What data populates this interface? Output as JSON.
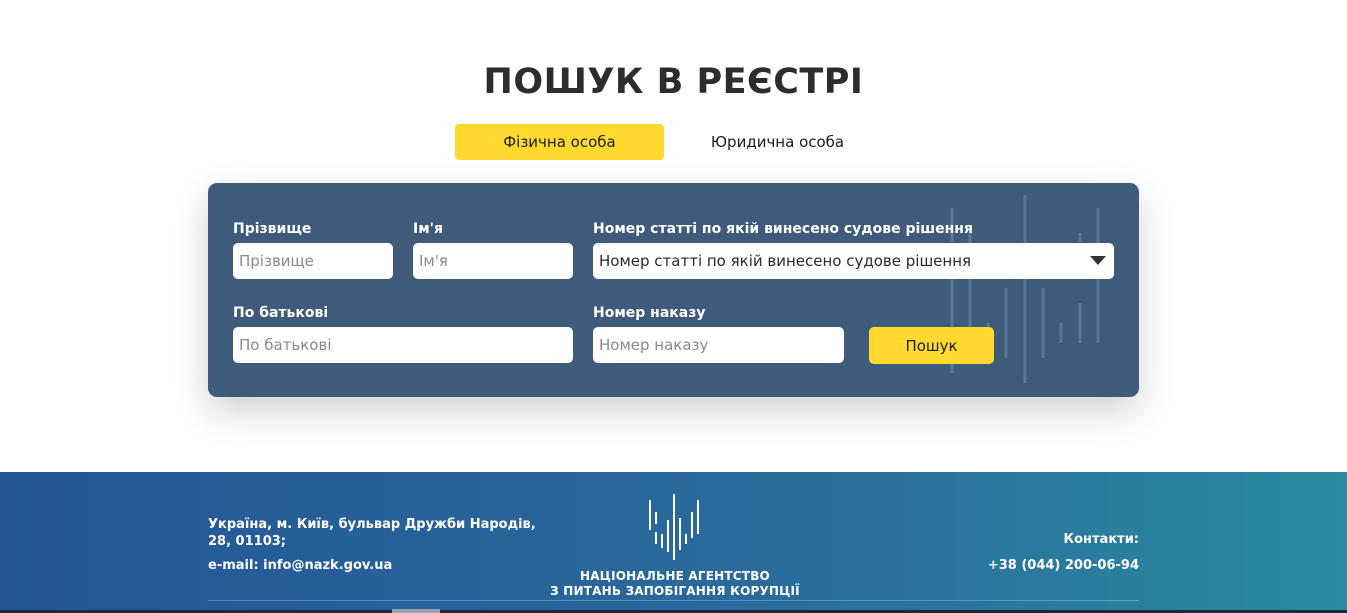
{
  "page": {
    "title": "ПОШУК В РЕЄСТРІ"
  },
  "tabs": [
    {
      "label": "Фізична особа",
      "active": true
    },
    {
      "label": "Юридична особа",
      "active": false
    }
  ],
  "form": {
    "surname": {
      "label": "Прізвище",
      "placeholder": "Прізвище",
      "value": ""
    },
    "name": {
      "label": "Ім'я",
      "placeholder": "Ім'я",
      "value": ""
    },
    "article": {
      "label": "Номер статті по якій винесено судове рішення",
      "selected": "Номер статті по якій винесено судове рішення"
    },
    "patronymic": {
      "label": "По батькові",
      "placeholder": "По батькові",
      "value": ""
    },
    "order": {
      "label": "Номер наказу",
      "placeholder": "Номер наказу",
      "value": ""
    },
    "search_button": "Пошук"
  },
  "footer": {
    "address": "Україна, м. Київ, бульвар Дружби Народів, 28, 01103;",
    "email": "e-mail: info@nazk.gov.ua",
    "org_line1": "НАЦІОНАЛЬНЕ АГЕНТСТВО",
    "org_line2": "З ПИТАНЬ ЗАПОБІГАННЯ КОРУПЦІЇ",
    "contacts_label": "Контакти:",
    "phone": "+38 (044) 200-06-94"
  },
  "colors": {
    "accent": "#ffd92e",
    "panel": "#3e5b7c",
    "footer_start": "#235597",
    "footer_end": "#2a8aa0"
  },
  "icons": {
    "dropdown": "chevron-down-icon",
    "logo": "nazk-logo-icon"
  }
}
